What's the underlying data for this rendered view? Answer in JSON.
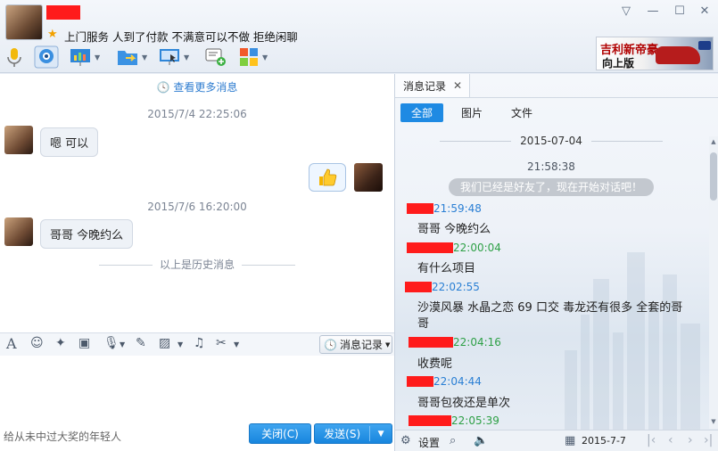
{
  "header": {
    "signature": "上门服务 人到了付款 不满意可以不做 拒绝闲聊",
    "window_controls": [
      "▽",
      "—",
      "☐",
      "✕"
    ],
    "ad": {
      "line1": "吉利新帝豪",
      "line2": "向上版"
    }
  },
  "chat": {
    "view_more": "查看更多消息",
    "messages": [
      {
        "timestamp": "2015/7/4 22:25:06",
        "text": "嗯 可以"
      },
      {
        "timestamp": "2015/7/6 16:20:00",
        "text": "哥哥 今晚约么"
      }
    ],
    "history_divider": "以上是历史消息"
  },
  "input": {
    "history_button": "消息记录",
    "placeholder": "给从未中过大奖的年轻人",
    "close_label": "关闭(C)",
    "send_label": "发送(S)"
  },
  "history": {
    "tab_label": "消息记录",
    "filters": [
      "全部",
      "图片",
      "文件"
    ],
    "date": "2015-07-04",
    "first_time": "21:58:38",
    "system_msg": "我们已经是好友了，现在开始对话吧！",
    "entries": [
      {
        "time": "21:59:48",
        "text": "哥哥 今晚约么"
      },
      {
        "time": "22:00:04",
        "text": "有什么项目"
      },
      {
        "time": "22:02:55",
        "text": "沙漠风暴 水晶之恋 69 口交 毒龙还有很多 全套的哥哥"
      },
      {
        "time": "22:04:16",
        "text": "收费呢"
      },
      {
        "time": "22:04:44",
        "text": "哥哥包夜还是单次"
      },
      {
        "time": "22:05:39",
        "text": ""
      }
    ],
    "settings_label": "设置",
    "current_date": "2015-7-7"
  },
  "colors": {
    "accent": "#1e8ae3",
    "redact": "#ff1b1b",
    "peer_time": "#2a7fd4",
    "self_time": "#2ea046"
  }
}
